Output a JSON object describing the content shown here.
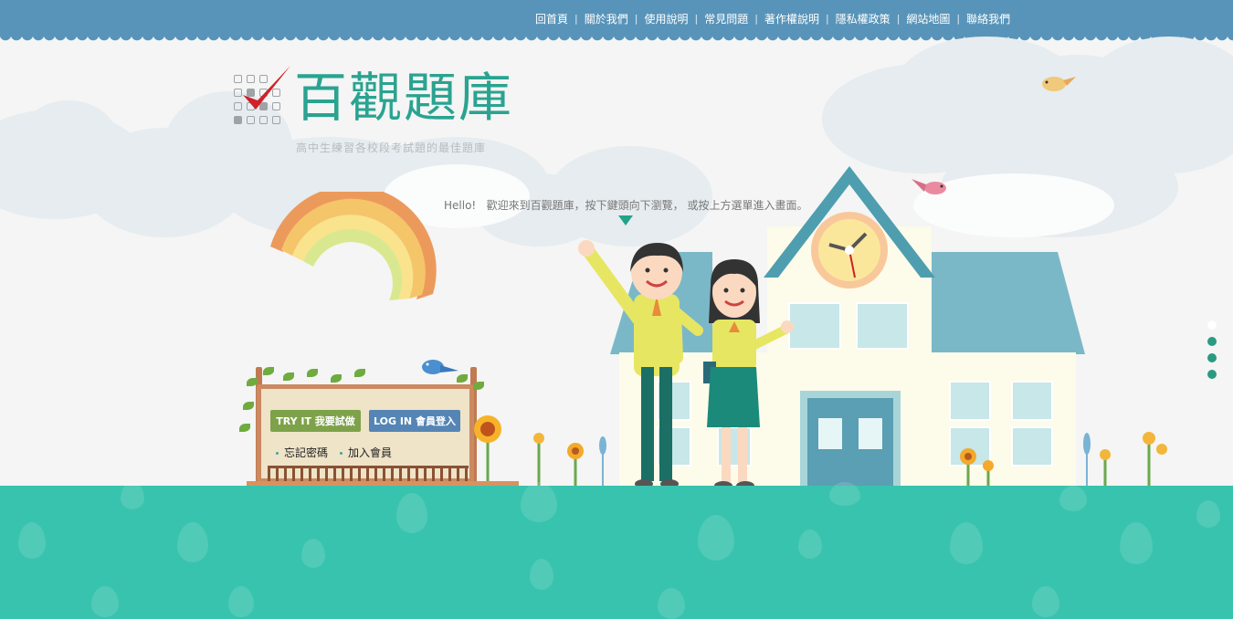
{
  "nav": {
    "items": [
      "回首頁",
      "關於我們",
      "使用說明",
      "常見問題",
      "著作權說明",
      "隱私權政策",
      "網站地圖",
      "聯絡我們"
    ],
    "separator": "|"
  },
  "logo": {
    "title": "百觀題庫",
    "tagline": "高中生練習各校段考試題的最佳題庫"
  },
  "welcome": {
    "text": "Hello!   歡迎來到百觀題庫，按下鍵頭向下瀏覽， 或按上方選單進入畫面。"
  },
  "board": {
    "try_label": "TRY IT 我要試做",
    "login_label": "LOG IN 會員登入",
    "forgot_label": "忘記密碼",
    "join_label": "加入會員"
  },
  "page_dots": {
    "count": 4,
    "active_index": 0
  },
  "colors": {
    "nav_bar": "#5894b9",
    "brand_teal": "#2aa391",
    "ground": "#38c3ae",
    "try_button": "#7ea24a",
    "login_button": "#5585b5",
    "check_red": "#d0202a"
  },
  "icons": {
    "down_arrow": "chevron-down-icon",
    "check": "checkmark-icon",
    "link_bullet": "bullet-icon"
  }
}
